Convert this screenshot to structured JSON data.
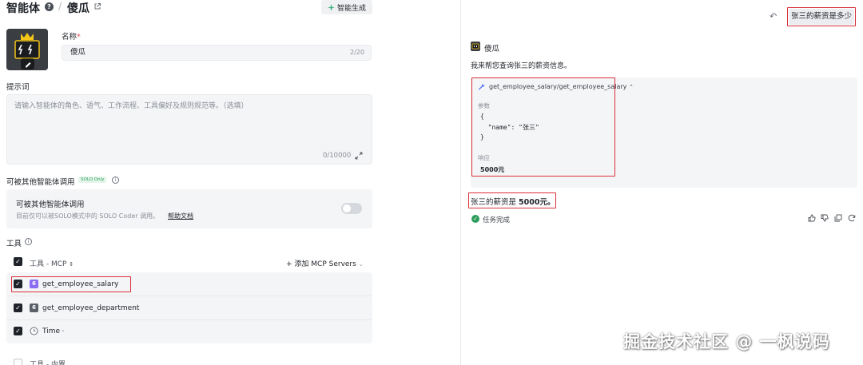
{
  "header": {
    "section_title": "智能体",
    "help_glyph": "?",
    "separator": "/",
    "agent_name": "傻瓜",
    "smart_generate_label": "智能生成"
  },
  "form": {
    "name_label": "名称",
    "required_mark": "*",
    "name_value": "傻瓜",
    "name_count": "2/20",
    "prompt_label": "提示词",
    "prompt_placeholder": "请输入智能体的角色、语气、工作流程、工具偏好及规则规范等。（选填）",
    "prompt_count": "0/10000",
    "callable_label": "可被其他智能体调用",
    "solo_badge": "SOLO Only",
    "callable_card_title": "可被其他智能体调用",
    "callable_card_desc": "目前仅可以被SOLO模式中的 SOLO Coder 调用。",
    "help_doc_link": "帮助文档",
    "callable_enabled": false
  },
  "tools": {
    "section_label": "工具",
    "mcp_header": "工具 - MCP",
    "add_mcp_label": "添加 MCP Servers",
    "items": [
      {
        "name": "get_employee_salary",
        "tag": "6",
        "checked": true,
        "highlighted": true
      },
      {
        "name": "get_employee_department",
        "tag": "6",
        "checked": true,
        "highlighted": false
      },
      {
        "name": "Time",
        "tag": "clock",
        "checked": true,
        "highlighted": false
      }
    ],
    "builtin_header": "工具 - 内置"
  },
  "chat": {
    "user_message": "张三的薪资是多少",
    "bot_name": "傻瓜",
    "bot_intro": "我来帮您查询张三的薪资信息。",
    "tool_call": {
      "title": "get_employee_salary/get_employee_salary",
      "params_label": "参数",
      "params_lines": [
        "{",
        "  \"name\": \"张三\"",
        "}"
      ],
      "response_label": "响应",
      "response_value": "5000元"
    },
    "answer_prefix": "张三的薪资是 ",
    "answer_bold": "5000元。",
    "task_status": "任务完成"
  },
  "watermark": "掘金技术社区 @ 一枫说码",
  "colors": {
    "highlight_red": "#d9303a",
    "success_green": "#2e9d5b",
    "tool_tag_purple": "#8b6cf2",
    "tool_tag_gray": "#5b6068"
  }
}
